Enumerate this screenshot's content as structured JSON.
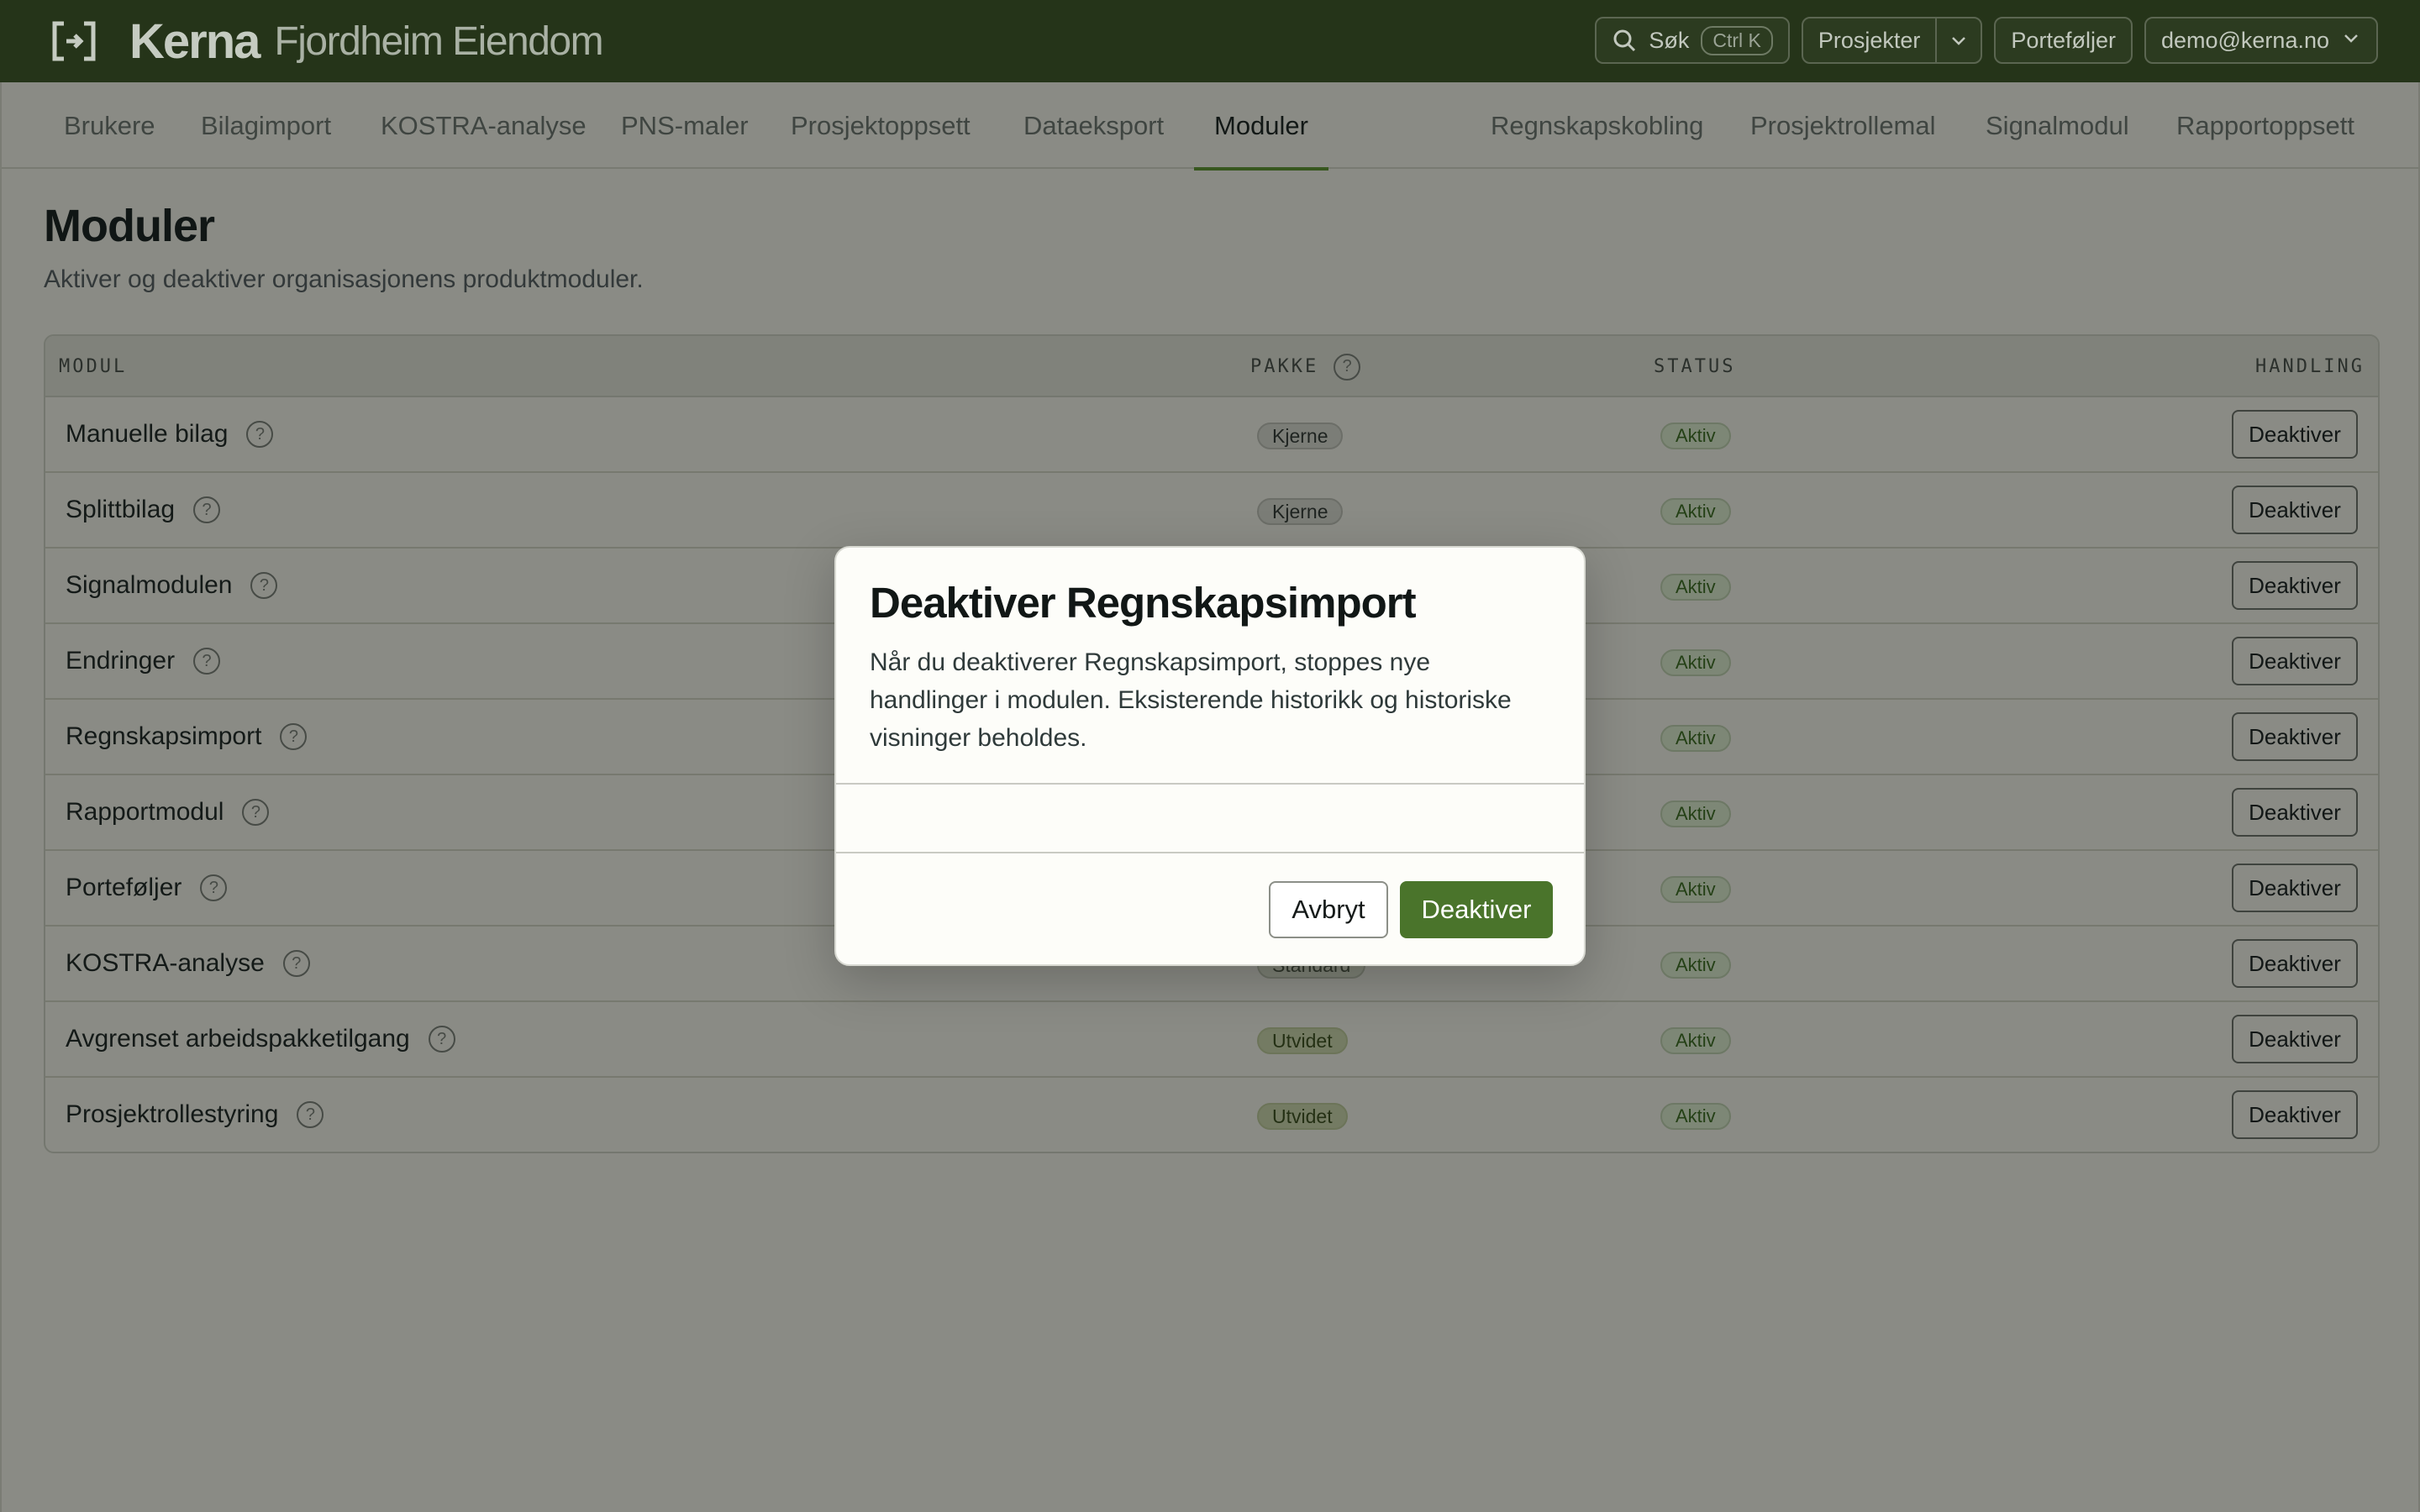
{
  "header": {
    "brand_name": "Kerna",
    "org_name": "Fjordheim Eiendom",
    "search_label": "Søk",
    "search_shortcut": "Ctrl K",
    "projects_label": "Prosjekter",
    "portfolios_label": "Porteføljer",
    "user_email": "demo@kerna.no"
  },
  "tabs_left": [
    "Brukere",
    "Bilagimport",
    "KOSTRA-analyse",
    "PNS-maler",
    "Prosjektoppsett",
    "Dataeksport",
    "Moduler"
  ],
  "tabs_right": [
    "Regnskapskobling",
    "Prosjektrollemal",
    "Signalmodul",
    "Rapportoppsett"
  ],
  "active_tab": "Moduler",
  "page": {
    "title": "Moduler",
    "subtitle": "Aktiver og deaktiver organisasjonens produktmoduler."
  },
  "table": {
    "columns": {
      "module": "MODUL",
      "package": "PAKKE",
      "status": "STATUS",
      "action": "HANDLING"
    },
    "rows": [
      {
        "name": "Manuelle bilag",
        "package": "Kjerne",
        "status": "Aktiv",
        "action": "Deaktiver"
      },
      {
        "name": "Splittbilag",
        "package": "Kjerne",
        "status": "Aktiv",
        "action": "Deaktiver"
      },
      {
        "name": "Signalmodulen",
        "package": "",
        "status": "Aktiv",
        "action": "Deaktiver"
      },
      {
        "name": "Endringer",
        "package": "",
        "status": "Aktiv",
        "action": "Deaktiver"
      },
      {
        "name": "Regnskapsimport",
        "package": "",
        "status": "Aktiv",
        "action": "Deaktiver"
      },
      {
        "name": "Rapportmodul",
        "package": "",
        "status": "Aktiv",
        "action": "Deaktiver"
      },
      {
        "name": "Porteføljer",
        "package": "",
        "status": "Aktiv",
        "action": "Deaktiver"
      },
      {
        "name": "KOSTRA-analyse",
        "package": "Standard",
        "status": "Aktiv",
        "action": "Deaktiver"
      },
      {
        "name": "Avgrenset arbeidspakketilgang",
        "package": "Utvidet",
        "status": "Aktiv",
        "action": "Deaktiver"
      },
      {
        "name": "Prosjektrollestyring",
        "package": "Utvidet",
        "status": "Aktiv",
        "action": "Deaktiver"
      }
    ]
  },
  "modal": {
    "title": "Deaktiver Regnskapsimport",
    "body": "Når du deaktiverer Regnskapsimport, stoppes nye handlinger i modulen. Eksisterende historikk og historiske visninger beholdes.",
    "cancel_label": "Avbryt",
    "confirm_label": "Deaktiver"
  },
  "colors": {
    "topbar": "#253419",
    "accent": "#4a742b",
    "overlay": "#8a8b85"
  }
}
